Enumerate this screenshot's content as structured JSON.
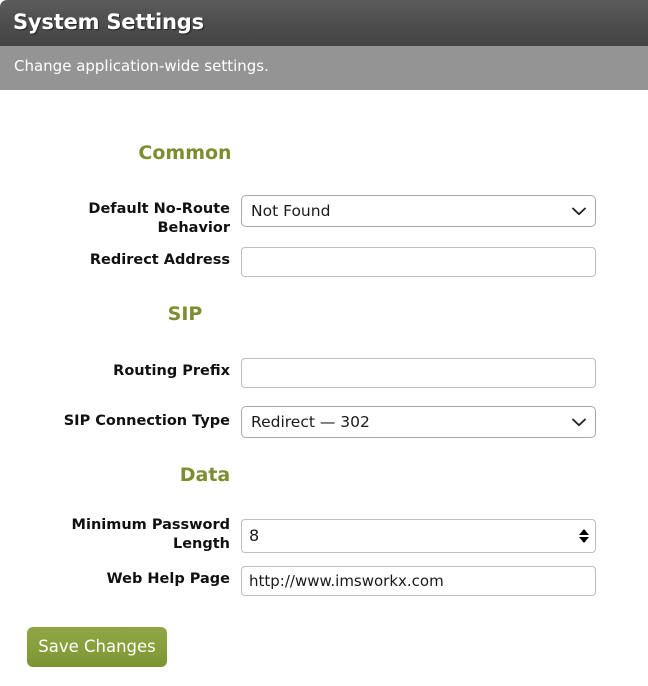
{
  "header": {
    "title": "System Settings",
    "subtitle": "Change application-wide settings."
  },
  "colors": {
    "header_gradient_top": "#5c5c5c",
    "header_gradient_bottom": "#434343",
    "subheader_bg": "#949494",
    "section_heading": "#7f8c2f",
    "button_green": "#87a03c",
    "field_border": "#bdbdbd",
    "text": "#111111"
  },
  "sections": [
    {
      "id": "common",
      "heading": "Common",
      "fields": [
        {
          "id": "default-no-route-behavior",
          "label": "Default No-Route Behavior",
          "type": "select",
          "value": "Not Found",
          "icon": "chevron-down-icon"
        },
        {
          "id": "redirect-address",
          "label": "Redirect Address",
          "type": "text",
          "value": "",
          "placeholder": ""
        }
      ]
    },
    {
      "id": "sip",
      "heading": "SIP",
      "fields": [
        {
          "id": "routing-prefix",
          "label": "Routing Prefix",
          "type": "text",
          "value": "",
          "placeholder": ""
        },
        {
          "id": "sip-connection-type",
          "label": "SIP Connection Type",
          "type": "select",
          "value": "Redirect — 302",
          "icon": "chevron-down-icon"
        }
      ]
    },
    {
      "id": "data",
      "heading": "Data",
      "fields": [
        {
          "id": "minimum-password-length",
          "label": "Minimum Password Length",
          "type": "number",
          "value": "8",
          "spinner_up_icon": "triangle-up-icon",
          "spinner_down_icon": "triangle-down-icon"
        },
        {
          "id": "web-help-page",
          "label": "Web Help Page",
          "type": "text",
          "value": "http://www.imsworkx.com",
          "placeholder": ""
        }
      ]
    }
  ],
  "actions": {
    "save_label": "Save Changes"
  }
}
